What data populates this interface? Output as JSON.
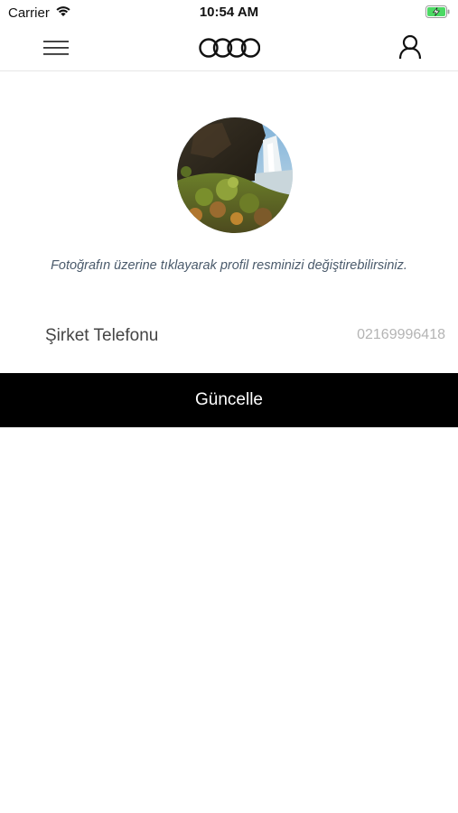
{
  "status_bar": {
    "carrier": "Carrier",
    "time": "10:54 AM",
    "battery_color": "#4cd964"
  },
  "nav": {
    "menu_icon": "hamburger-menu-icon",
    "logo_icon": "four-rings-logo",
    "profile_icon": "user-icon"
  },
  "profile": {
    "hint": "Fotoğrafın üzerine tıklayarak profil resminizi değiştirebilirsiniz."
  },
  "phone": {
    "label": "Şirket Telefonu",
    "value": "02169996418"
  },
  "actions": {
    "update_label": "Güncelle"
  },
  "colors": {
    "button_bg": "#000000",
    "button_text": "#ffffff",
    "hint_text": "#4a5a6b",
    "value_text": "#b4b4b4"
  }
}
